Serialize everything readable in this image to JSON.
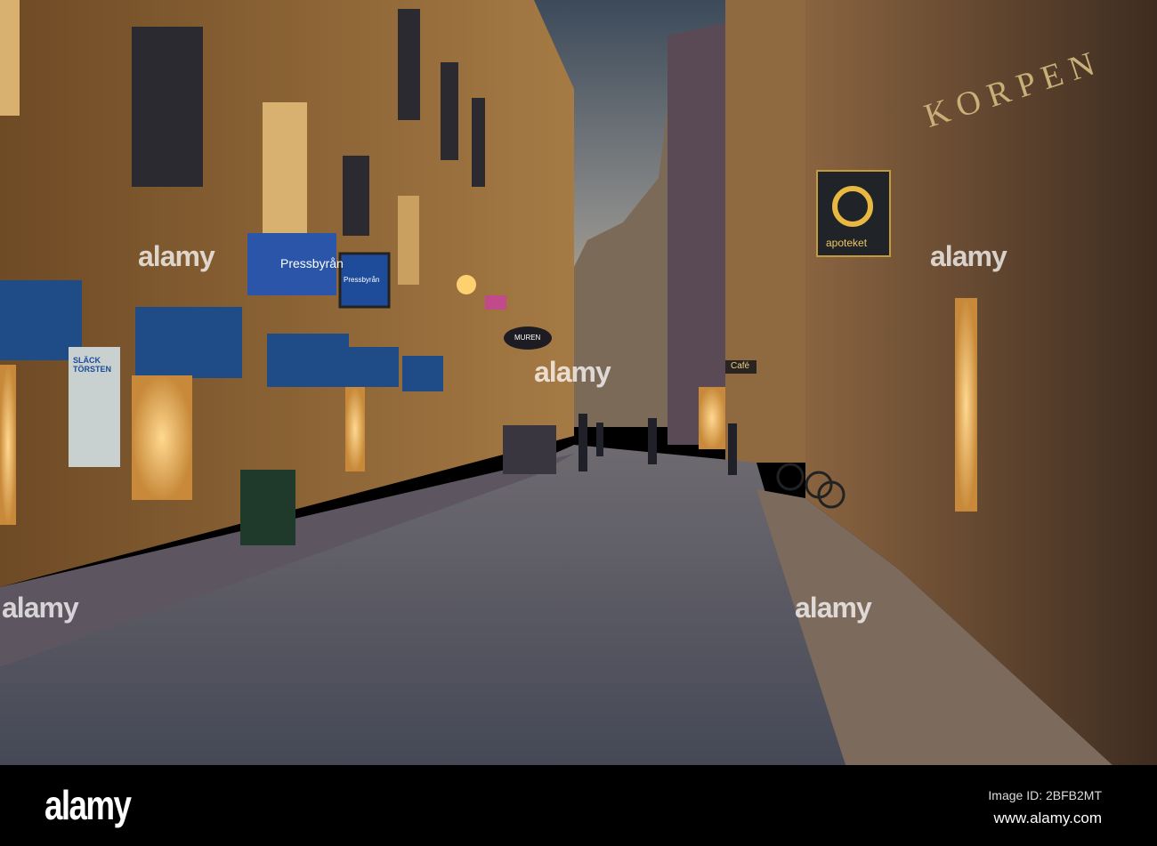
{
  "signs": {
    "pressbyran": "Pressbyrån",
    "pressbyran_small": "Pressbyrån",
    "apoteket": "apoteket",
    "korpen": "K O R P E N",
    "muren": "MUREN",
    "cafe": "Café",
    "poster": "SLÄCK TÖRSTEN"
  },
  "watermark": {
    "text": "alamy"
  },
  "footer": {
    "logo": "alamy",
    "image_id": "Image ID: 2BFB2MT",
    "url": "www.alamy.com"
  },
  "colors": {
    "sky_top": "#3c4a5a",
    "sky_bottom": "#c9b596",
    "facade_left": "#8a6434",
    "facade_right": "#6a4a30",
    "awning": "#1f4c86",
    "street": "#5a5f6e"
  }
}
